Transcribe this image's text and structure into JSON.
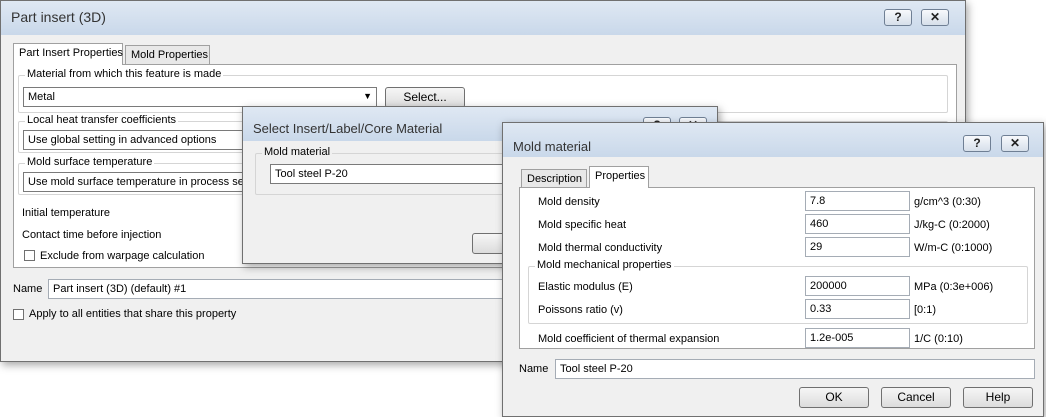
{
  "part": {
    "title": "Part insert (3D)",
    "help": "?",
    "close": "✕",
    "tabs": [
      "Part Insert Properties",
      "Mold Properties"
    ],
    "material_group": "Material from which this feature is made",
    "material_value": "Metal",
    "select_button": "Select...",
    "htc_group": "Local heat transfer coefficients",
    "htc_value": "Use global setting in advanced options",
    "mst_group": "Mold surface temperature",
    "mst_value": "Use mold surface temperature in process sett",
    "initial_temp": "Initial temperature",
    "contact_time": "Contact time before injection",
    "exclude": "Exclude from warpage calculation",
    "name_label": "Name",
    "name_value": "Part insert (3D) (default) #1",
    "apply_all": "Apply to all entities that share this property"
  },
  "select": {
    "title": "Select Insert/Label/Core Material",
    "group": "Mold material",
    "value": "Tool steel P-20",
    "help": "?",
    "close": "✕"
  },
  "mold": {
    "title": "Mold material",
    "help": "?",
    "close": "✕",
    "tabs": [
      "Description",
      "Properties"
    ],
    "rows": [
      {
        "label": "Mold density",
        "value": "7.8",
        "unit": "g/cm^3 (0:30)"
      },
      {
        "label": "Mold specific heat",
        "value": "460",
        "unit": "J/kg-C (0:2000)"
      },
      {
        "label": "Mold thermal conductivity",
        "value": "29",
        "unit": "W/m-C (0:1000)"
      }
    ],
    "mech_group": "Mold mechanical properties",
    "mech_rows": [
      {
        "label": "Elastic modulus (E)",
        "value": "200000",
        "unit": "MPa (0:3e+006)"
      },
      {
        "label": "Poissons ratio (v)",
        "value": "0.33",
        "unit": "[0:1)"
      }
    ],
    "cte": {
      "label": "Mold coefficient of thermal expansion",
      "value": "1.2e-005",
      "unit": "1/C (0:10)"
    },
    "name_label": "Name",
    "name_value": "Tool steel P-20",
    "ok": "OK",
    "cancel": "Cancel",
    "help_button": "Help"
  }
}
